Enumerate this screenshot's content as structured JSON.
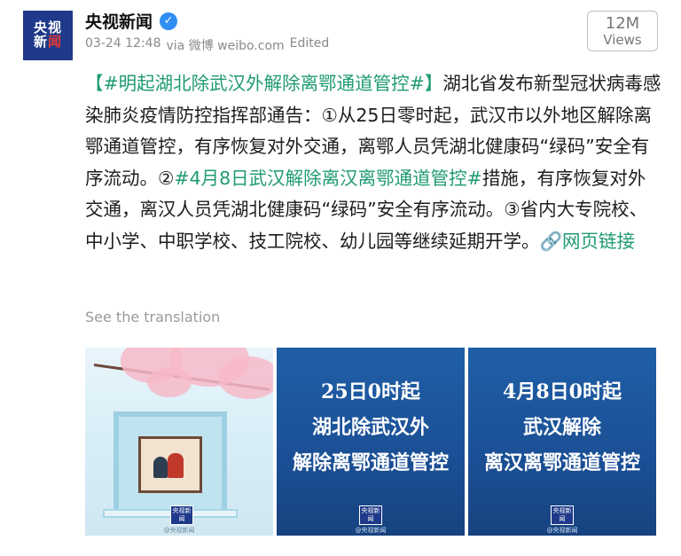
{
  "header": {
    "avatar": {
      "line1": "央视",
      "line2a": "新",
      "line2b": "闻"
    },
    "account_name": "央视新闻",
    "verified_icon": "check",
    "timestamp": "03-24 12:48",
    "via": "via 微博 weibo.com",
    "edited": "Edited",
    "views_count": "12M",
    "views_label": "Views"
  },
  "post": {
    "tag1": "【#明起湖北除武汉外解除离鄂通道管控#】",
    "text1": "湖北省发布新型冠状病毒感染肺炎疫情防控指挥部通告：①从25日零时起，武汉市以外地区解除离鄂通道管控，有序恢复对外交通，离鄂人员凭湖北健康码“绿码”安全有序流动。②",
    "tag2": "#4月8日武汉解除离汉离鄂通道管控#",
    "text2": "措施，有序恢复对外交通，离汉人员凭湖北健康码“绿码”安全有序流动。③省内大专院校、中小学、中职学校、技工院校、幼儿园等继续延期开学。",
    "link_icon": "link",
    "link_text": "网页链接",
    "translate": "See the translation"
  },
  "images": {
    "image2_line1": "25日0时起",
    "image2_line2": "湖北除武汉外",
    "image2_line3": "解除离鄂通道管控",
    "image3_line1": "4月8日0时起",
    "image3_line2": "武汉解除",
    "image3_line3": "离汉离鄂通道管控",
    "logo_text": "央视新闻",
    "watermark": "@央视新闻"
  },
  "colors": {
    "tag_green": "#1f9a74",
    "avatar_blue": "#1f3a8a",
    "card_blue": "#1b4f95"
  }
}
